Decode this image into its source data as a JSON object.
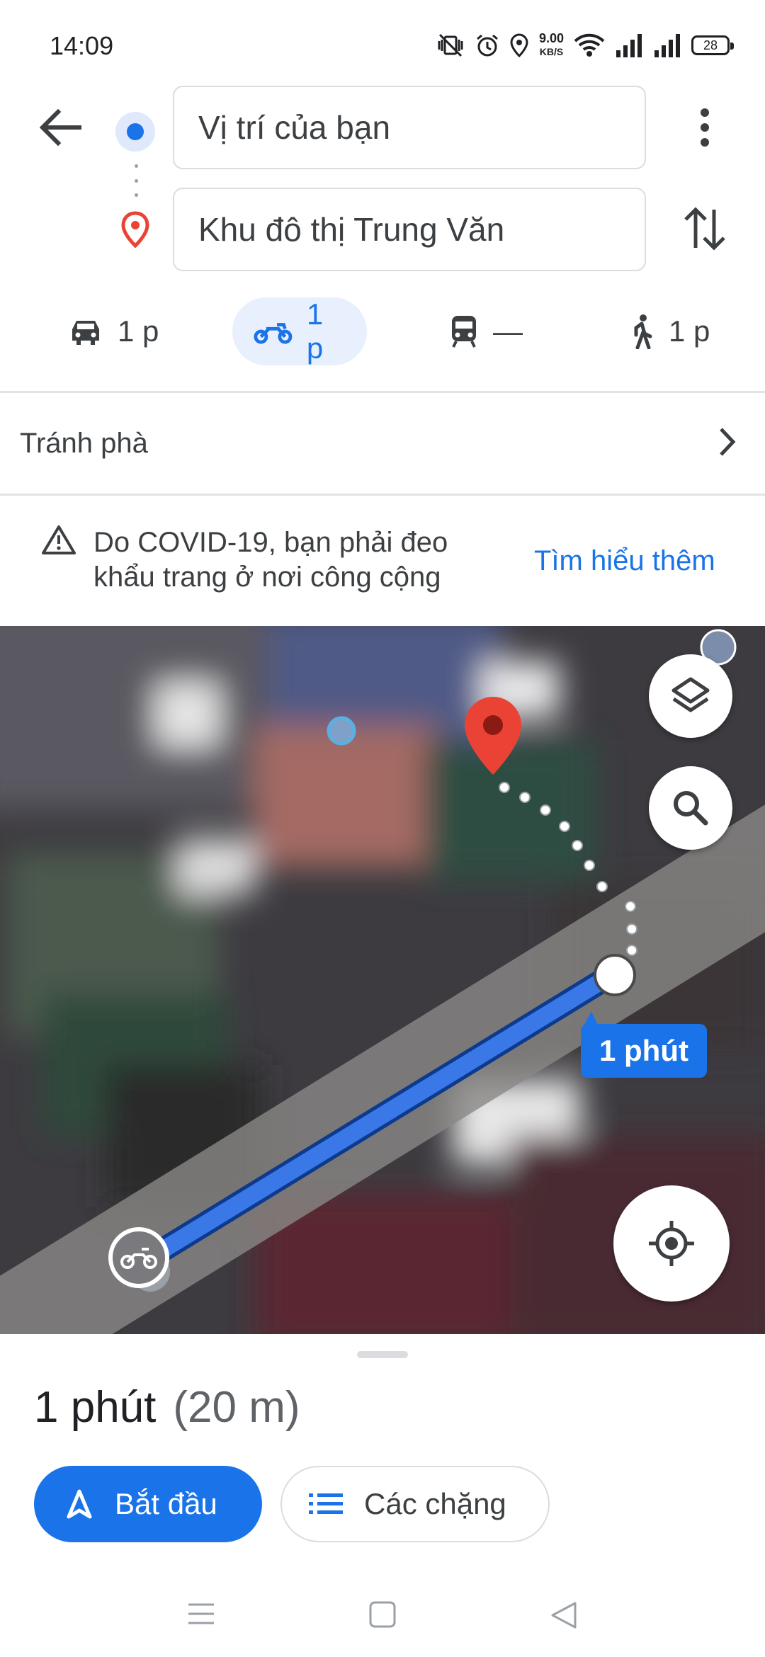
{
  "status_bar": {
    "time": "14:09",
    "speed_value": "9.00",
    "speed_unit": "KB/S",
    "battery": "28"
  },
  "search": {
    "origin": "Vị trí của bạn",
    "destination": "Khu đô thị Trung Văn"
  },
  "modes": [
    {
      "name": "car",
      "label": "1 p"
    },
    {
      "name": "motorcycle",
      "label": "1 p",
      "selected": true
    },
    {
      "name": "transit",
      "label": "—"
    },
    {
      "name": "walk",
      "label": "1 p"
    }
  ],
  "options": {
    "avoid_label": "Tránh phà"
  },
  "notice": {
    "text": "Do COVID-19, bạn phải đeo khẩu trang ở nơi công cộng",
    "link": "Tìm hiểu thêm"
  },
  "map": {
    "route_label": "1 phút"
  },
  "sheet": {
    "duration": "1 phút",
    "distance": "(20 m)",
    "start_label": "Bắt đầu",
    "steps_label": "Các chặng"
  },
  "colors": {
    "accent": "#1a73e8",
    "route": "#3b78e7",
    "pin": "#ea4335"
  }
}
